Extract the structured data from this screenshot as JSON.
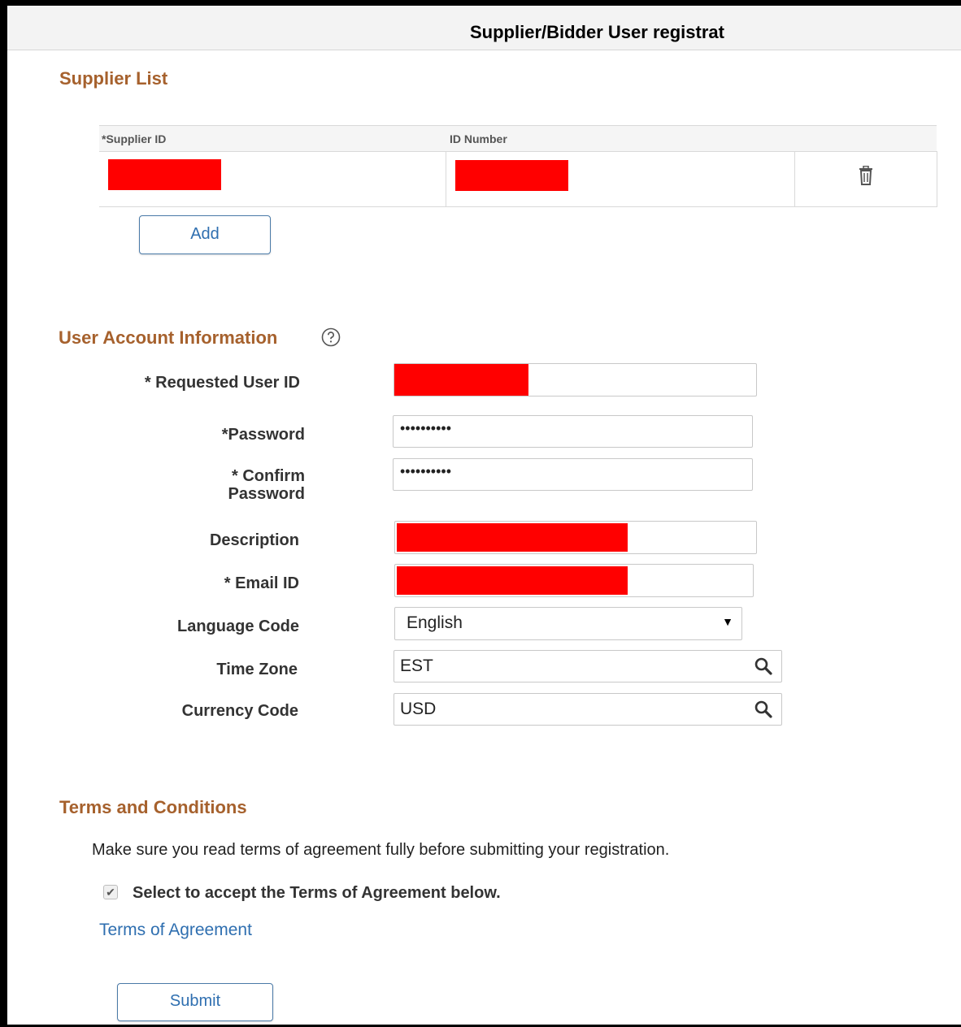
{
  "header": {
    "title": "Supplier/Bidder User registrat"
  },
  "supplier_list": {
    "title": "Supplier List",
    "columns": [
      "*Supplier ID",
      "ID Number"
    ],
    "add_label": "Add"
  },
  "user_account": {
    "title": "User Account Information",
    "labels": {
      "requested_user_id": "* Requested User ID",
      "password": "*Password",
      "confirm_password_line1": "* Confirm",
      "confirm_password_line2": "Password",
      "description": "Description",
      "email_id": "* Email ID",
      "language_code": "Language Code",
      "time_zone": "Time Zone",
      "currency_code": "Currency Code"
    },
    "values": {
      "password": "••••••••••",
      "confirm_password": "••••••••••",
      "language_code": "English",
      "time_zone": "EST",
      "currency_code": "USD"
    }
  },
  "terms": {
    "title": "Terms and Conditions",
    "text": "Make sure you read terms of agreement fully before submitting your registration.",
    "accept_label": "Select to accept the Terms of Agreement below.",
    "accept_checked": true,
    "link_label": "Terms of Agreement",
    "submit_label": "Submit"
  },
  "colors": {
    "section_title": "#a6612d",
    "link": "#2f6fb0",
    "redaction": "#ff0000"
  },
  "icons": [
    "trash-icon",
    "help-icon",
    "dropdown-caret-icon",
    "search-icon",
    "checkmark-icon"
  ]
}
